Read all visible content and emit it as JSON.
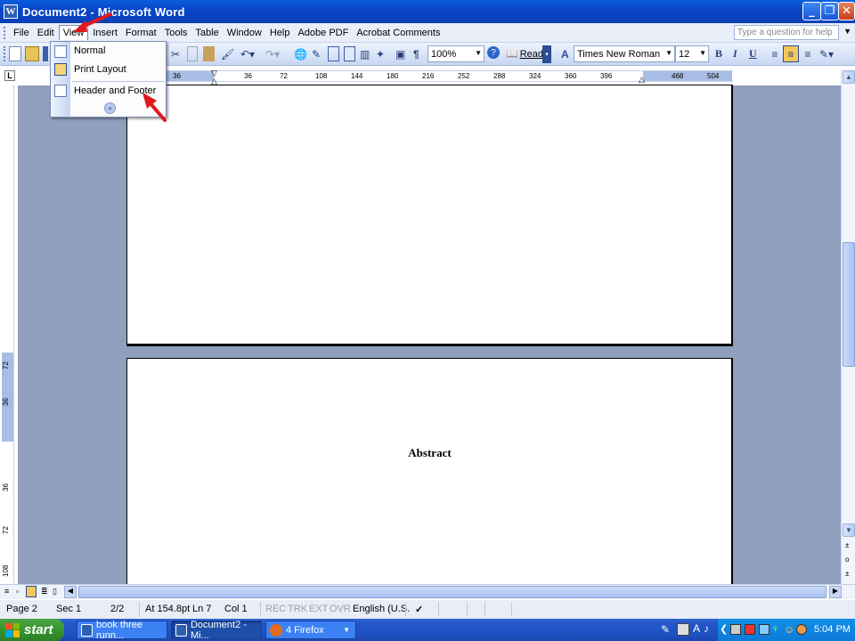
{
  "window": {
    "title": "Document2 - Microsoft Word"
  },
  "menubar": {
    "items": [
      "File",
      "Edit",
      "View",
      "Insert",
      "Format",
      "Tools",
      "Table",
      "Window",
      "Help",
      "Adobe PDF",
      "Acrobat Comments"
    ],
    "help_placeholder": "Type a question for help"
  },
  "view_menu": {
    "items": [
      {
        "label": "Normal",
        "icon": "normal-view-icon"
      },
      {
        "label": "Print Layout",
        "icon": "print-layout-icon"
      },
      {
        "label": "Header and Footer",
        "icon": "header-footer-icon"
      }
    ],
    "expand_icon": "chevron-double-down-icon"
  },
  "toolbar": {
    "zoom": "100%",
    "read_label": "Read",
    "font_name": "Times New Roman",
    "font_size": "12",
    "bold": "B",
    "italic": "I",
    "underline": "U"
  },
  "ruler": {
    "h_ticks": [
      "36",
      "36",
      "72",
      "108",
      "144",
      "180",
      "216",
      "252",
      "288",
      "324",
      "360",
      "396",
      "468",
      "504"
    ],
    "v_ticks": [
      "72",
      "36",
      "36",
      "72",
      "108"
    ]
  },
  "document": {
    "abstract_heading": "Abstract"
  },
  "status": {
    "page": "Page 2",
    "sec": "Sec 1",
    "count": "2/2",
    "at": "At 154.8pt",
    "ln": "Ln 7",
    "col": "Col 1",
    "rec": "REC",
    "trk": "TRK",
    "ext": "EXT",
    "ovr": "OVR",
    "language": "English (U.S."
  },
  "taskbar": {
    "start_label": "start",
    "tasks": [
      {
        "label": "book three runn...",
        "icon": "word-doc-icon"
      },
      {
        "label": "Document2 - Mi...",
        "icon": "word-doc-icon"
      },
      {
        "label": "4 Firefox",
        "icon": "firefox-icon"
      }
    ],
    "clock": "5:04 PM"
  },
  "colors": {
    "titlebar": "#0846c8",
    "workspace": "#8f9fbd",
    "arrow": "#e0191e",
    "start": "#37962f"
  }
}
